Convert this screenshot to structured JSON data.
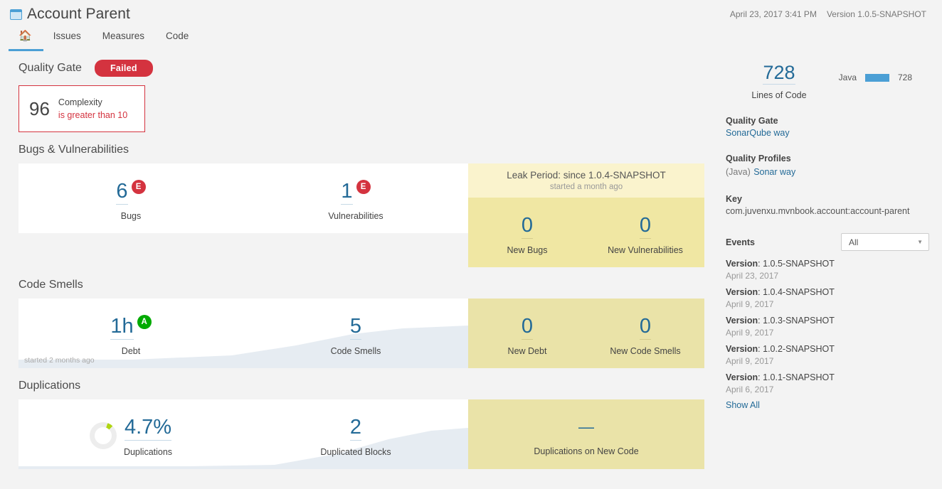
{
  "header": {
    "project_icon": "project-folder-icon",
    "title": "Account Parent",
    "date": "April 23, 2017 3:41 PM",
    "version": "Version 1.0.5-SNAPSHOT",
    "tabs": [
      {
        "label": "⌂",
        "name": "home",
        "active": true
      },
      {
        "label": "Issues",
        "name": "issues",
        "active": false
      },
      {
        "label": "Measures",
        "name": "measures",
        "active": false
      },
      {
        "label": "Code",
        "name": "code",
        "active": false
      }
    ]
  },
  "quality_gate": {
    "label": "Quality Gate",
    "status": "Failed",
    "status_color": "#d4333f",
    "condition": {
      "value": "96",
      "metric": "Complexity",
      "detail": "is greater than 10"
    }
  },
  "sections": {
    "bugs": {
      "title": "Bugs & Vulnerabilities",
      "metrics": [
        {
          "value": "6",
          "label": "Bugs",
          "rating": "E",
          "rating_color": "#d4333f"
        },
        {
          "value": "1",
          "label": "Vulnerabilities",
          "rating": "E",
          "rating_color": "#d4333f"
        }
      ],
      "leak": [
        {
          "value": "0",
          "label": "New Bugs"
        },
        {
          "value": "0",
          "label": "New Vulnerabilities"
        }
      ]
    },
    "code_smells": {
      "title": "Code Smells",
      "trend_note": "started 2 months ago",
      "metrics": [
        {
          "value": "1h",
          "label": "Debt",
          "rating": "A",
          "rating_color": "#00aa00"
        },
        {
          "value": "5",
          "label": "Code Smells",
          "rating": "",
          "rating_color": ""
        }
      ],
      "leak": [
        {
          "value": "0",
          "label": "New Debt"
        },
        {
          "value": "0",
          "label": "New Code Smells"
        }
      ]
    },
    "duplications": {
      "title": "Duplications",
      "metrics": [
        {
          "value": "4.7%",
          "label": "Duplications",
          "donut": true,
          "donut_pct": 4.7
        },
        {
          "value": "2",
          "label": "Duplicated Blocks",
          "donut": false
        }
      ],
      "leak": [
        {
          "value": "—",
          "label": "Duplications on New Code"
        }
      ]
    }
  },
  "leak_period": {
    "title": "Leak Period: since 1.0.4-SNAPSHOT",
    "subtitle": "started a month ago",
    "bg_color": "#f0e7a3"
  },
  "sidebar": {
    "lines_of_code": {
      "value": "728",
      "label": "Lines of Code"
    },
    "languages": [
      {
        "name": "Java",
        "value": "728",
        "bar_color": "#4b9fd5"
      }
    ],
    "quality_gate": {
      "heading": "Quality Gate",
      "link": "SonarQube way"
    },
    "quality_profiles": {
      "heading": "Quality Profiles",
      "lang": "(Java)",
      "link": "Sonar way"
    },
    "key": {
      "heading": "Key",
      "value": "com.juvenxu.mvnbook.account:account-parent"
    },
    "events": {
      "heading": "Events",
      "filter_selected": "All",
      "items": [
        {
          "prefix": "Version",
          "version": "1.0.5-SNAPSHOT",
          "date": "April 23, 2017"
        },
        {
          "prefix": "Version",
          "version": "1.0.4-SNAPSHOT",
          "date": "April 9, 2017"
        },
        {
          "prefix": "Version",
          "version": "1.0.3-SNAPSHOT",
          "date": "April 9, 2017"
        },
        {
          "prefix": "Version",
          "version": "1.0.2-SNAPSHOT",
          "date": "April 9, 2017"
        },
        {
          "prefix": "Version",
          "version": "1.0.1-SNAPSHOT",
          "date": "April 6, 2017"
        }
      ],
      "show_all": "Show All"
    }
  }
}
